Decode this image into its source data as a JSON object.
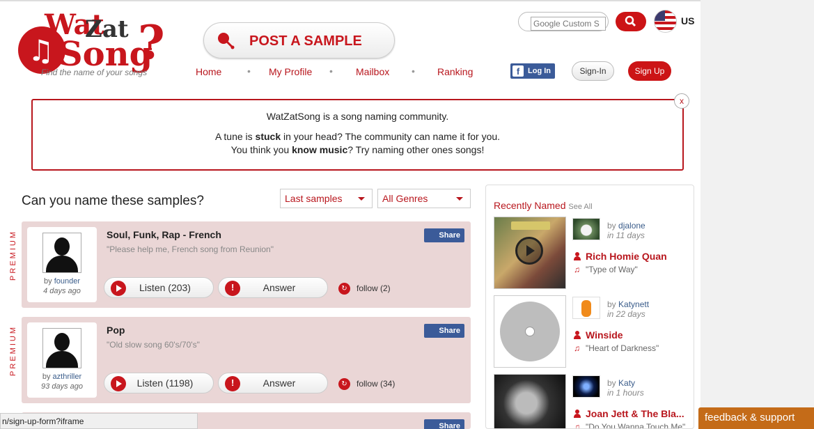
{
  "logo": {
    "wat": "Wat",
    "zat": "Zat",
    "song": "Song",
    "q": "?",
    "tagline": "Find the name of your songs"
  },
  "post_button": {
    "label": "POST A SAMPLE"
  },
  "nav": {
    "home": "Home",
    "profile": "My Profile",
    "mailbox": "Mailbox",
    "ranking": "Ranking",
    "sep": "•"
  },
  "auth": {
    "fb_login": "Log In",
    "signin": "Sign-In",
    "signup": "Sign Up"
  },
  "search": {
    "placeholder": "Google Custom S"
  },
  "locale": {
    "label": "US"
  },
  "intro": {
    "line1": "WatZatSong is a song naming community.",
    "line2_a": "A tune is ",
    "line2_b": "stuck",
    "line2_c": " in your head? The community can name it for you.",
    "line3_a": "You think you ",
    "line3_b": "know music",
    "line3_c": "? Try naming other ones songs!",
    "close": "x"
  },
  "samples": {
    "title": "Can you name these samples?",
    "filter_sort": "Last samples",
    "filter_genre": "All Genres",
    "premium_label": "PREMIUM",
    "share_label": "Share",
    "answer_label": "Answer",
    "items": [
      {
        "genre": "Soul, Funk, Rap - French",
        "desc": "\"Please help me, French song from Reunion\"",
        "by_prefix": "by ",
        "user": "founder",
        "ago": "4 days ago",
        "listen": "Listen (203)",
        "follow": "follow (2)"
      },
      {
        "genre": "Pop",
        "desc": "\"Old slow song 60's/70's\"",
        "by_prefix": "by ",
        "user": "azthriller",
        "ago": "93 days ago",
        "listen": "Listen (1198)",
        "follow": "follow (34)"
      },
      {
        "share": "Share"
      }
    ]
  },
  "recent": {
    "title": "Recently Named",
    "see_all": "See All",
    "items": [
      {
        "by_prefix": "by ",
        "user": "djalone",
        "in": "in 11 days",
        "artist": "Rich Homie Quan",
        "song": "\"Type of Way\""
      },
      {
        "by_prefix": "by ",
        "user": "Katynett",
        "in": "in 22 days",
        "artist": "Winside",
        "song": "\"Heart of Darkness\""
      },
      {
        "by_prefix": "by ",
        "user": "Katy",
        "in": "in 1 hours",
        "artist": "Joan Jett & The Bla...",
        "song": "\"Do You Wanna Touch Me\""
      }
    ]
  },
  "statusbar": {
    "text": "n/sign-up-form?iframe"
  },
  "feedback": {
    "label": "feedback & support"
  }
}
